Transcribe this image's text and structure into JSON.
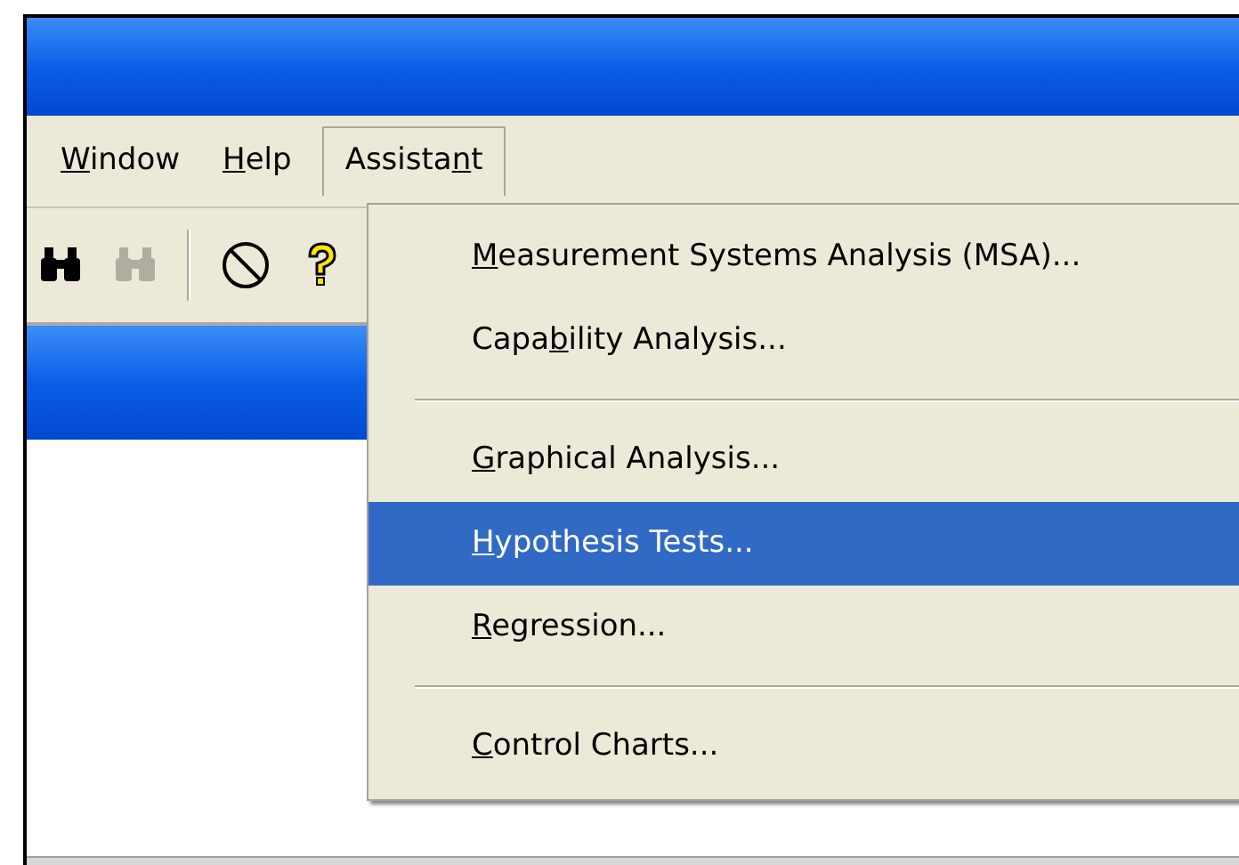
{
  "menu_bar": [
    {
      "label": {
        "key": "W",
        "post": "indow"
      },
      "open": false
    },
    {
      "label": {
        "key": "H",
        "post": "elp"
      },
      "open": false
    },
    {
      "label": {
        "pre": "Assista",
        "key": "n",
        "post": "t"
      },
      "open": true
    }
  ],
  "toolbar": [
    {
      "kind": "binoculars",
      "disabled": false
    },
    {
      "kind": "binoculars",
      "disabled": true
    },
    {
      "kind": "separator"
    },
    {
      "kind": "no-sign",
      "disabled": false
    },
    {
      "kind": "help",
      "disabled": false
    }
  ],
  "menu": [
    {
      "kind": "item",
      "label": {
        "key": "M",
        "post": "easurement Systems Analysis (MSA)..."
      },
      "selected": false
    },
    {
      "kind": "item",
      "label": {
        "pre": "Capa",
        "key": "b",
        "post": "ility Analysis..."
      },
      "selected": false
    },
    {
      "kind": "separator"
    },
    {
      "kind": "item",
      "label": {
        "key": "G",
        "post": "raphical Analysis..."
      },
      "selected": false
    },
    {
      "kind": "item",
      "label": {
        "key": "H",
        "post": "ypothesis Tests..."
      },
      "selected": true
    },
    {
      "kind": "item",
      "label": {
        "key": "R",
        "post": "egression..."
      },
      "selected": false
    },
    {
      "kind": "separator"
    },
    {
      "kind": "item",
      "label": {
        "key": "C",
        "post": "ontrol Charts..."
      },
      "selected": false
    }
  ]
}
